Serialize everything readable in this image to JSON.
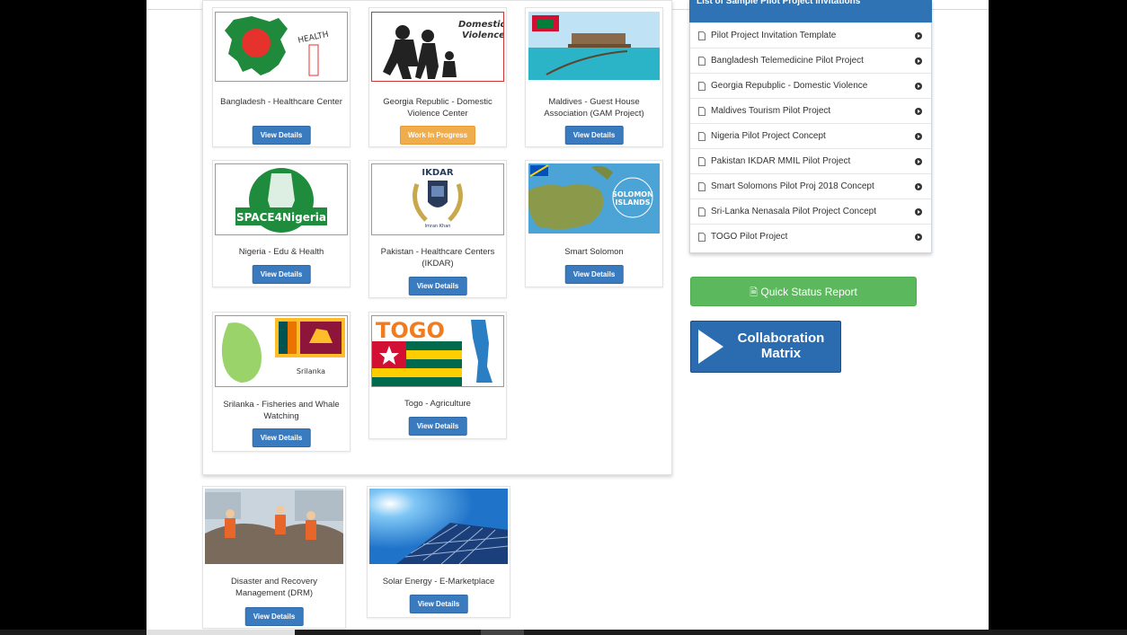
{
  "list": {
    "heading": "List of Sample Pilot Project Invitations",
    "items": [
      "Pilot Project Invitation Template",
      "Bangladesh Telemedicine Pilot Project",
      "Georgia Repubplic - Domestic Violence",
      "Maldives Tourism Pilot Project",
      "Nigeria Pilot Project Concept",
      "Pakistan IKDAR MMIL Pilot Project",
      "Smart Solomons Pilot Proj 2018 Concept",
      "Sri-Lanka Nenasala Pilot Project Concept",
      "TOGO Pilot Project"
    ]
  },
  "quick_status": "Quick Status Report",
  "collab": {
    "line1": "Collaboration",
    "line2": "Matrix"
  },
  "projects": [
    {
      "title": "Bangladesh - Healthcare Center",
      "button": "View Details",
      "thumb_text": "HEALTH"
    },
    {
      "title": "Georgia Republic - Domestic Violence Center",
      "button": "Work In Progress",
      "thumb_text1": "Domestic",
      "thumb_text2": "Violence"
    },
    {
      "title": "Maldives - Guest House Association (GAM Project)",
      "button": "View Details"
    },
    {
      "title": "Nigeria - Edu & Health",
      "button": "View Details",
      "thumb_text": "SPACE4Nigeria"
    },
    {
      "title": "Pakistan - Healthcare Centers (IKDAR)",
      "button": "View Details",
      "thumb_text": "IKDAR",
      "thumb_text2": "Imran Khan"
    },
    {
      "title": "Smart Solomon",
      "button": "View Details",
      "thumb_text1": "SOLOMON",
      "thumb_text2": "ISLANDS"
    },
    {
      "title": "Srilanka - Fisheries and Whale Watching",
      "button": "View Details",
      "thumb_text": "Srilanka"
    },
    {
      "title": "Togo - Agriculture",
      "button": "View Details",
      "thumb_text": "TOGO"
    },
    {
      "title": "Disaster and Recovery Management (DRM)",
      "button": "View Details"
    },
    {
      "title": "Solar Energy - E-Marketplace",
      "button": "View Details"
    }
  ]
}
